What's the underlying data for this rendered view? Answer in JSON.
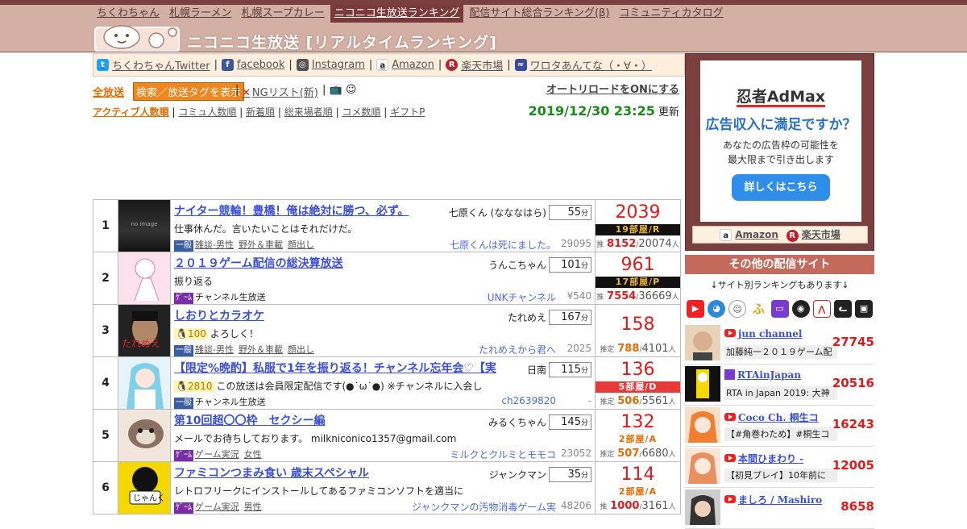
{
  "nav": {
    "items": [
      "ちくわちゃん",
      "札幌ラーメン",
      "札幌スープカレー",
      "ニコニコ生放送ランキング",
      "配信サイト総合ランキング(β)",
      "コミュニティカタログ"
    ],
    "site_title": "ニコニコ生放送 [リアルタイムランキング]"
  },
  "links": {
    "twitter": "ちくわちゃんTwitter",
    "facebook": "facebook",
    "instagram": "Instagram",
    "amazon": "Amazon",
    "rakuten": "楽天市場",
    "wrota": "ワロタあんてな（・∀・）"
  },
  "controls": {
    "show_all": "全放送",
    "tag_toggle": "検索／放送タグを表示",
    "ng_list": "NGリスト(新)",
    "autoreload": "オートリロードをONにする"
  },
  "sort": {
    "items": [
      "アクティブ人数順",
      "コミュ人数順",
      "新着順",
      "総来場者順",
      "コメ数順",
      "ギフトP"
    ]
  },
  "updated": {
    "datetime": "2019/12/30 23:25",
    "suffix": "更新"
  },
  "ranking": [
    {
      "rank": "1",
      "title": "ナイター競輪！豊橋！俺は絶対に勝つ、必ず。",
      "owner": "七原くん (なななはら)",
      "minutes": "55",
      "desc": "仕事休んだ。言いたいことはそれだけだ。",
      "level": "",
      "category": "一般",
      "tags": [
        "雑談-男性",
        "野外＆車載",
        "顔出し"
      ],
      "community": "七原くんは死にました。",
      "comm_id": "29095",
      "viewers": "2039",
      "room": "19部屋/R",
      "est_label": "推",
      "est_a": "8152",
      "est_b": "20074",
      "unit": "人"
    },
    {
      "rank": "2",
      "title": "２０１９ゲーム配信の総決算放送",
      "owner": "うんこちゃん",
      "minutes": "101",
      "desc": "振り返る",
      "level": "",
      "category": "ｹﾞｰﾑ",
      "tags": [],
      "plain": "チャンネル生放送",
      "community": "UNKチャンネル",
      "comm_id": "¥540",
      "viewers": "961",
      "room": "17部屋/P",
      "est_label": "推",
      "est_a": "7554",
      "est_b": "36669",
      "unit": "人"
    },
    {
      "rank": "3",
      "title": "しおりとカラオケ",
      "owner": "たれめえ",
      "minutes": "167",
      "desc": "よろしく！",
      "level": "100",
      "category": "一般",
      "tags": [
        "雑談-男性",
        "野外＆車載",
        "顔出し"
      ],
      "community": "たれめえから君へ",
      "comm_id": "2025",
      "viewers": "158",
      "room": "",
      "est_label": "推定",
      "est_a": "788",
      "est_b": "4101",
      "unit": "人"
    },
    {
      "rank": "4",
      "title": "【限定%晩酌】私服で1年を振り返る！チャンネル忘年会♡【実",
      "owner": "日南",
      "minutes": "115",
      "desc": "この放送は会員限定配信です(●˙ω˙●) ※チャンネルに入会し",
      "level": "2810",
      "category": "一般",
      "tags": [],
      "plain": "チャンネル生放送",
      "community": "ch2639820",
      "comm_id": "-",
      "viewers": "136",
      "room": "5部屋/D",
      "est_label": "推定",
      "est_a": "506",
      "est_b": "5561",
      "unit": "人"
    },
    {
      "rank": "5",
      "title": "第10回超〇〇枠　セクシー編",
      "owner": "みるくちゃん",
      "minutes": "145",
      "desc": "メールでお待ちしております。 milkniconico1357@gmail.com",
      "level": "",
      "category": "ｹﾞｰﾑ",
      "tags": [
        "ゲーム実況",
        "女性"
      ],
      "community": "ミルクとクルミとモモコ",
      "comm_id": "23052",
      "viewers": "132",
      "room": "2部屋/A",
      "est_label": "推定",
      "est_a": "507",
      "est_b": "6680",
      "unit": "人"
    },
    {
      "rank": "6",
      "title": "ファミコンつまみ食い 歳末スペシャル",
      "owner": "ジャンクマン",
      "minutes": "35",
      "desc": "レトロフリークにインストールしてあるファミコンソフトを適当に",
      "level": "",
      "category": "ｹﾞｰﾑ",
      "tags": [
        "ゲーム実況",
        "男性"
      ],
      "community": "ジャンクマンの汚物消毒ゲーム実",
      "comm_id": "48206",
      "viewers": "114",
      "room": "2部屋/A",
      "est_label": "推",
      "est_a": "1000",
      "est_b": "3161",
      "unit": "人"
    }
  ],
  "ad": {
    "brand": "忍者AdMax",
    "headline": "広告収入に満足ですか？",
    "sub1": "あなたの広告枠の可能性を",
    "sub2": "最大限まで引き出します",
    "button": "詳しくはこちら",
    "amazon": "Amazon",
    "rakuten": "楽天市場"
  },
  "others": {
    "heading": "その他の配信サイト",
    "note": "↓サイト別ランキングもあります↓",
    "items": [
      {
        "name": "jun channel",
        "desc": "加藤純一２０１９ゲーム配",
        "count": "27745",
        "site": "youtube"
      },
      {
        "name": "RTAinJapan",
        "desc": "RTA in Japan 2019: 大神",
        "count": "20516",
        "site": "twitch"
      },
      {
        "name": "Coco Ch. 桐生コ",
        "desc": "【#角巻わため】#桐生コ",
        "count": "16243",
        "site": "youtube"
      },
      {
        "name": "本間ひまわり -",
        "desc": "【初見プレイ】10年前に",
        "count": "12005",
        "site": "youtube"
      },
      {
        "name": "ましろ / Mashiro",
        "desc": "",
        "count": "8658",
        "site": "youtube"
      }
    ]
  },
  "colors": {
    "header_bg": "#d4b0a4",
    "accent_brown": "#7a4040",
    "link_blue": "#3b4fd4",
    "viewer_red": "#e01a1a",
    "updated_green": "#1a8a1a"
  }
}
